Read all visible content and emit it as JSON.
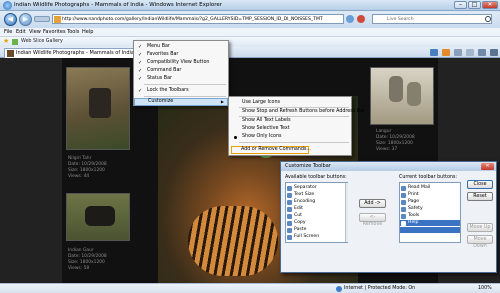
{
  "window": {
    "title": "Indian Wildlife Photographs - Mammals of India - Windows Internet Explorer",
    "send_feedback": "Send Feedback",
    "minimize": "–",
    "maximize": "□",
    "close": "✕"
  },
  "address_bar": {
    "url": "http://www.nandphoto.com/gallery/IndianWildlife/Mammals/?g2_GALLERYSID=TMP_SESSION_ID_DI_NOISSES_TMT",
    "search_placeholder": "Live Search",
    "back": "◀",
    "forward": "▶"
  },
  "menubar": [
    "File",
    "Edit",
    "View",
    "Favorites",
    "Tools",
    "Help"
  ],
  "favorites_bar": {
    "link": "Web Slice Gallery"
  },
  "tab": {
    "label": "Indian Wildlife Photographs - Mammals of India"
  },
  "gallery": [
    {
      "title": "Nilgiri Tahr",
      "date": "Date: 10/29/2008",
      "size": "Size: 1800x1200",
      "views": "Views: 44"
    },
    {
      "title": "Indian Gaur",
      "date": "Date: 10/29/2008",
      "size": "Size: 1800x1200",
      "views": "Views: 58"
    },
    {
      "title": "Langur",
      "date": "Date: 10/29/2008",
      "size": "Size: 1800x1200",
      "views": "Views: 37"
    }
  ],
  "toolbars_menu": {
    "items": [
      {
        "label": "Menu Bar",
        "checked": true
      },
      {
        "label": "Favorites Bar",
        "checked": true
      },
      {
        "label": "Compatibility View Button",
        "checked": true
      },
      {
        "label": "Command Bar",
        "checked": true
      },
      {
        "label": "Status Bar",
        "checked": true
      },
      {
        "label": "Lock the Toolbars",
        "checked": true
      },
      {
        "label": "Customize",
        "checked": false,
        "submenu_arrow": "▶"
      }
    ]
  },
  "customize_menu": {
    "items": [
      {
        "label": "Use Large Icons"
      },
      {
        "label": "Show Stop and Refresh Buttons before Address Bar"
      },
      {
        "label": "Show All Text Labels"
      },
      {
        "label": "Show Selective Text"
      },
      {
        "label": "Show Only Icons",
        "selected": true
      },
      {
        "label": "Add or Remove Commands..."
      }
    ]
  },
  "dialog": {
    "title": "Customize Toolbar",
    "available_label": "Available toolbar buttons:",
    "current_label": "Current toolbar buttons:",
    "available": [
      "Separator",
      "Text Size",
      "Encoding",
      "Edit",
      "Cut",
      "Copy",
      "Paste",
      "Full Screen"
    ],
    "current": [
      "Read Mail",
      "Print",
      "Page",
      "Safety",
      "Tools",
      "Help",
      ""
    ],
    "current_selected_index": 5,
    "buttons": {
      "add": "Add ->",
      "remove": "<- Remove",
      "close": "Close",
      "reset": "Reset",
      "move_up": "Move Up",
      "move_down": "Move Down"
    }
  },
  "status": {
    "zone": "Internet | Protected Mode: On",
    "zoom": "100%"
  },
  "colors": {
    "accent": "#2f6fb3",
    "highlight": "#cfe3f7",
    "outline": "#e8a000"
  }
}
